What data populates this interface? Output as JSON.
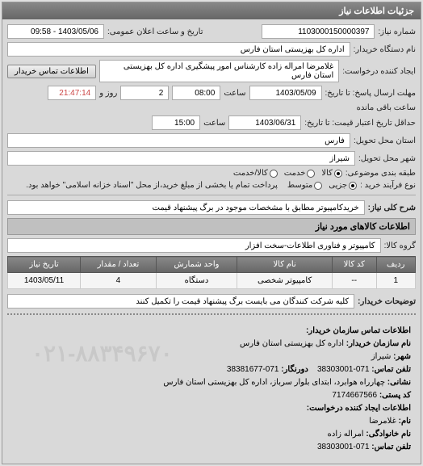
{
  "header": {
    "title": "جزئیات اطلاعات نیاز"
  },
  "fields": {
    "need_number_label": "شماره نیاز:",
    "need_number": "1103000150000397",
    "announce_label": "تاریخ و ساعت اعلان عمومی:",
    "announce": "1403/05/06 - 09:58",
    "buyer_label": "نام دستگاه خریدار:",
    "buyer": "اداره کل بهزیستی استان فارس",
    "requester_label": "ایجاد کننده درخواست:",
    "requester": "غلامرضا امراله زاده کارشناس امور پیشگیری اداره کل بهزیستی استان فارس",
    "contact_btn": "اطلاعات تماس خریدار",
    "deadline_label": "مهلت ارسال پاسخ: تا تاریخ:",
    "deadline_date": "1403/05/09",
    "deadline_time_label": "ساعت",
    "deadline_time": "08:00",
    "days": "2",
    "days_label": "روز و",
    "remain_time": "21:47:14",
    "remain_label": "ساعت باقی مانده",
    "validity_label": "حداقل تاریخ اعتبار قیمت: تا تاریخ:",
    "validity_date": "1403/06/31",
    "validity_time_label": "ساعت",
    "validity_time": "15:00",
    "province_label": "استان محل تحویل:",
    "province": "فارس",
    "city_label": "شهر محل تحویل:",
    "city": "شیراز",
    "category_label": "طبقه بندی موضوعی:",
    "cat_kala": "کالا",
    "cat_khadamat": "خدمت",
    "cat_both": "کالا/خدمت",
    "process_label": "نوع فرآیند خرید :",
    "proc_jozi": "جزیی",
    "proc_motevaset": "متوسط",
    "proc_note": "پرداخت تمام یا بخشی از مبلغ خرید،از محل \"اسناد خزانه اسلامی\" خواهد بود.",
    "subject_label": "شرح کلی نیاز:",
    "subject": "خریدکامپیوتر مطابق با مشخصات موجود در برگ پیشنهاد قیمت",
    "goods_title": "اطلاعات کالاهای مورد نیاز",
    "group_label": "گروه کالا:",
    "group": "کامپیوتر و فناوری اطلاعات-سخت افزار",
    "notes_label": "توضیحات خریدار:",
    "notes": "کلیه شرکت کنندگان می بایست برگ پیشنهاد قیمت را تکمیل کنند"
  },
  "table": {
    "headers": [
      "ردیف",
      "کد کالا",
      "نام کالا",
      "واحد شمارش",
      "تعداد / مقدار",
      "تاریخ نیاز"
    ],
    "rows": [
      {
        "idx": "1",
        "code": "--",
        "name": "کامپیوتر شخصی",
        "unit": "دستگاه",
        "qty": "4",
        "date": "1403/05/11"
      }
    ]
  },
  "contact": {
    "title": "اطلاعات تماس سازمان خریدار:",
    "org_label": "نام سازمان خریدار:",
    "org": "اداره کل بهزیستی استان فارس",
    "city_label": "شهر:",
    "city": "شیراز",
    "phone_label": "تلفن تماس:",
    "phone": "071-38303001",
    "fax_label": "دورنگار:",
    "fax": "071-38381677",
    "address_label": "نشانی:",
    "address": "چهارراه هوابرد، ابتدای بلوار سرباز، اداره کل بهزیستی استان فارس",
    "postal_label": "کد پستی:",
    "postal": "7174667566",
    "creator_title": "اطلاعات ایجاد کننده درخواست:",
    "name_label": "نام:",
    "name": "غلامرضا",
    "family_label": "نام خانوادگی:",
    "family": "امراله زاده",
    "creator_phone_label": "تلفن تماس:",
    "creator_phone": "071-38303001",
    "watermark": "۰۲۱-۸۸۳۴۹۶۷۰"
  }
}
